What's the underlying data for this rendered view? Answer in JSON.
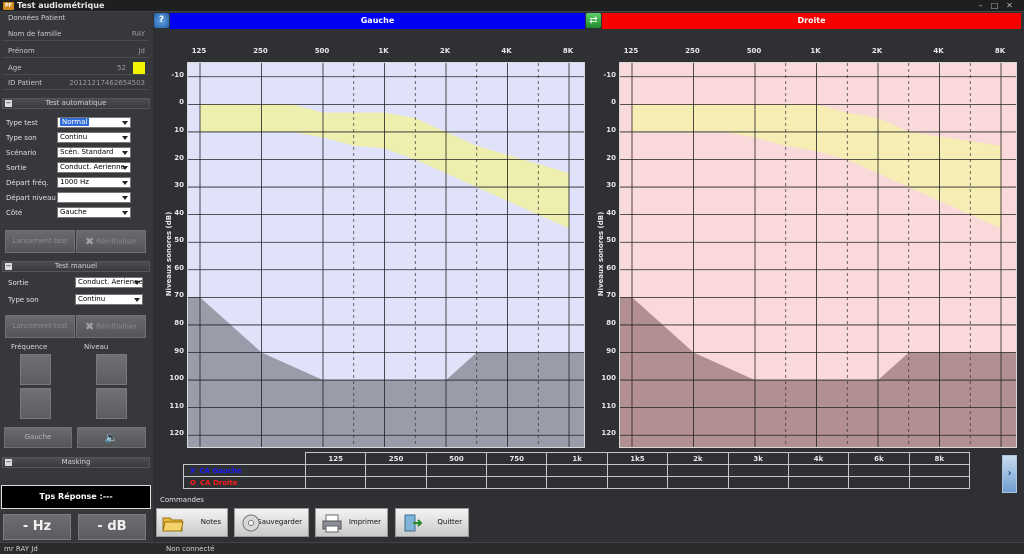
{
  "window": {
    "title": "Test audiométrique",
    "app_icon": "PF"
  },
  "patient": {
    "section": "Données Patient",
    "rows": [
      {
        "label": "Nom de famille",
        "value": "RAY"
      },
      {
        "label": "Prénom",
        "value": "Jd"
      },
      {
        "label": "Age",
        "value": "52"
      },
      {
        "label": "ID Patient",
        "value": "20121217462654503"
      }
    ],
    "age_indicator_color": "#f4f400"
  },
  "auto_test": {
    "section": "Test automatique",
    "fields": [
      {
        "label": "Type test",
        "value": "Normal"
      },
      {
        "label": "Type son",
        "value": "Continu"
      },
      {
        "label": "Scénario",
        "value": "Scén. Standard"
      },
      {
        "label": "Sortie",
        "value": "Conduct. Aerienne"
      },
      {
        "label": "Départ fréq.",
        "value": "1000 Hz"
      },
      {
        "label": "Départ niveau",
        "value": ""
      },
      {
        "label": "Côté",
        "value": "Gauche"
      }
    ],
    "launch_label": "Lancement test",
    "reset_label": "Réinitialiser"
  },
  "manual_test": {
    "section": "Test manuel",
    "fields": [
      {
        "label": "Sortie",
        "value": "Conduct. Aerienne"
      },
      {
        "label": "Type son",
        "value": "Continu"
      }
    ],
    "launch_label": "Lancement test",
    "reset_label": "Réinitialiser",
    "freq_label": "Fréquence",
    "level_label": "Niveau",
    "side_label": "Gauche"
  },
  "masking": {
    "section": "Masking"
  },
  "response": {
    "label": "Tps Réponse :---"
  },
  "readout": {
    "hz": "- Hz",
    "db": "- dB"
  },
  "channels": {
    "left": "Gauche",
    "right": "Droite",
    "left_color": "#0000ff",
    "right_color": "#ff0000"
  },
  "chart_data": [
    {
      "type": "line",
      "title": "Gauche",
      "ylabel": "Niveaux sonores (dB)",
      "x_ticks": [
        "125",
        "250",
        "500",
        "1K",
        "2K",
        "4K",
        "8K"
      ],
      "y_ticks": [
        -10,
        0,
        10,
        20,
        30,
        40,
        50,
        60,
        70,
        80,
        90,
        100,
        110,
        120
      ],
      "ylim": [
        -15,
        125
      ],
      "y_inverted": true,
      "grid": true,
      "background_color": "#d4d8f6",
      "normal_zone": {
        "color": "#f1f1a2",
        "upper_dB": [
          0,
          0,
          0,
          0,
          3,
          3,
          3,
          5,
          10,
          15,
          25
        ],
        "lower_dB": [
          10,
          10,
          10,
          10,
          12,
          15,
          16,
          20,
          25,
          30,
          45
        ]
      },
      "limit_zone": {
        "color": "#7d7f88",
        "level_dB": [
          70,
          80,
          90,
          95,
          100,
          100,
          100,
          100,
          100,
          90,
          90
        ]
      },
      "series_points_octave": [
        0,
        0.5,
        1,
        1.5,
        2,
        2.5,
        3,
        3.5,
        4,
        4.5,
        6
      ]
    },
    {
      "type": "line",
      "title": "Droite",
      "ylabel": "Niveaux sonores (dB)",
      "x_ticks": [
        "125",
        "250",
        "500",
        "1K",
        "2K",
        "4K",
        "8K"
      ],
      "y_ticks": [
        -10,
        0,
        10,
        20,
        30,
        40,
        50,
        60,
        70,
        80,
        90,
        100,
        110,
        120
      ],
      "ylim": [
        -15,
        125
      ],
      "y_inverted": true,
      "grid": true,
      "background_color": "#f7cdcd",
      "normal_zone": {
        "color": "#f6f0ae",
        "upper_dB": [
          0,
          0,
          0,
          0,
          0,
          0,
          0,
          3,
          5,
          10,
          15
        ],
        "lower_dB": [
          10,
          10,
          10,
          10,
          12,
          15,
          17,
          20,
          25,
          30,
          45
        ]
      },
      "limit_zone": {
        "color": "#946f71",
        "level_dB": [
          70,
          80,
          90,
          95,
          100,
          100,
          100,
          100,
          100,
          90,
          90
        ]
      },
      "series_points_octave": [
        0,
        0.5,
        1,
        1.5,
        2,
        2.5,
        3,
        3.5,
        4,
        4.5,
        6
      ]
    }
  ],
  "freq_table": {
    "headers": [
      "125",
      "250",
      "500",
      "750",
      "1k",
      "1k5",
      "2k",
      "3k",
      "4k",
      "6k",
      "8k"
    ],
    "rows": [
      {
        "label": "CA Gauche",
        "marker": "X",
        "color": "#1a1aff"
      },
      {
        "label": "CA Droite",
        "marker": "O",
        "color": "#ff1a1a"
      }
    ]
  },
  "commands": {
    "label": "Commandes",
    "buttons": [
      {
        "label": "Notes"
      },
      {
        "label": "Sauvegarder"
      },
      {
        "label": "Imprimer"
      },
      {
        "label": "Quitter"
      }
    ]
  },
  "status": {
    "user": "mr RAY Jd",
    "connection": "Non connecté"
  }
}
